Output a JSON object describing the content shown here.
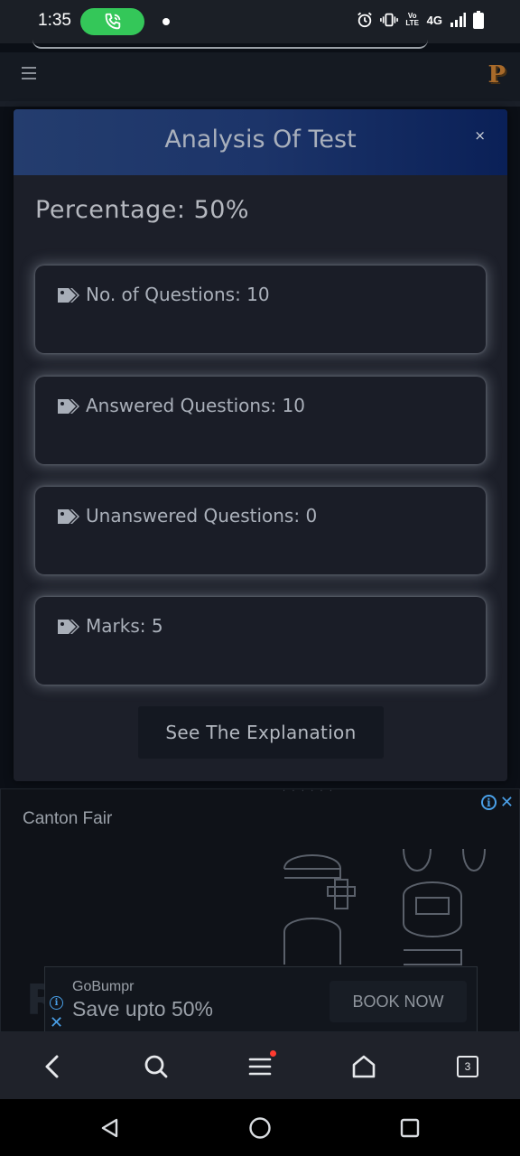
{
  "status_bar": {
    "time": "1:35",
    "network": "4G",
    "volte": "Vo LTE",
    "call_color": "#34c759"
  },
  "site_header": {
    "logo": "P",
    "logo_color": "#a86a2a"
  },
  "modal": {
    "title": "Analysis Of Test",
    "close": "×",
    "percentage": "Percentage: 50%",
    "stats": [
      {
        "icon": "tag-icon",
        "text": "No. of Questions: 10"
      },
      {
        "icon": "tag-icon",
        "text": "Answered Questions: 10"
      },
      {
        "icon": "tag-icon",
        "text": "Unanswered Questions: 0"
      },
      {
        "icon": "tag-icon",
        "text": "Marks: 5"
      }
    ],
    "explain_button": "See The Explanation",
    "header_gradient": [
      "#243d6e",
      "#0a2057"
    ]
  },
  "ad": {
    "title": "Canton Fair",
    "banner": {
      "brand": "GoBumpr",
      "offer": "Save upto 50%",
      "cta": "BOOK NOW"
    },
    "info_color": "#4aa0e8"
  },
  "browser_bar": {
    "tab_count": "3",
    "icons": [
      "back-icon",
      "search-icon",
      "menu-icon",
      "home-icon",
      "tabs-icon"
    ]
  },
  "system_nav": {
    "icons": [
      "back-triangle-icon",
      "home-circle-icon",
      "recents-square-icon"
    ]
  }
}
